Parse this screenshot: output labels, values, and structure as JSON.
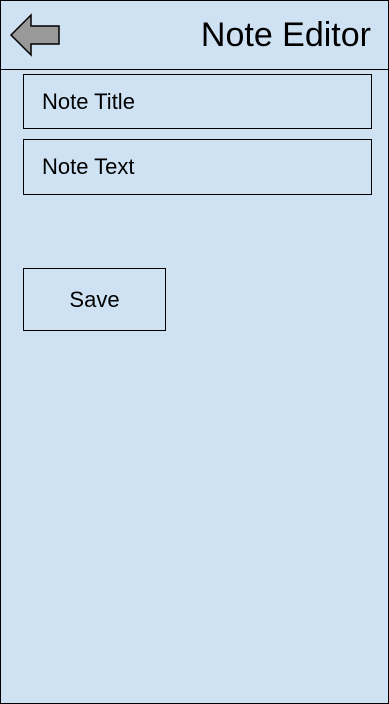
{
  "header": {
    "title": "Note Editor",
    "back_icon": "back-arrow-icon"
  },
  "form": {
    "title_placeholder": "Note Title",
    "text_placeholder": "Note Text",
    "save_label": "Save"
  },
  "colors": {
    "background": "#cfe2f3",
    "border": "#000000",
    "arrow_fill": "#999999"
  }
}
